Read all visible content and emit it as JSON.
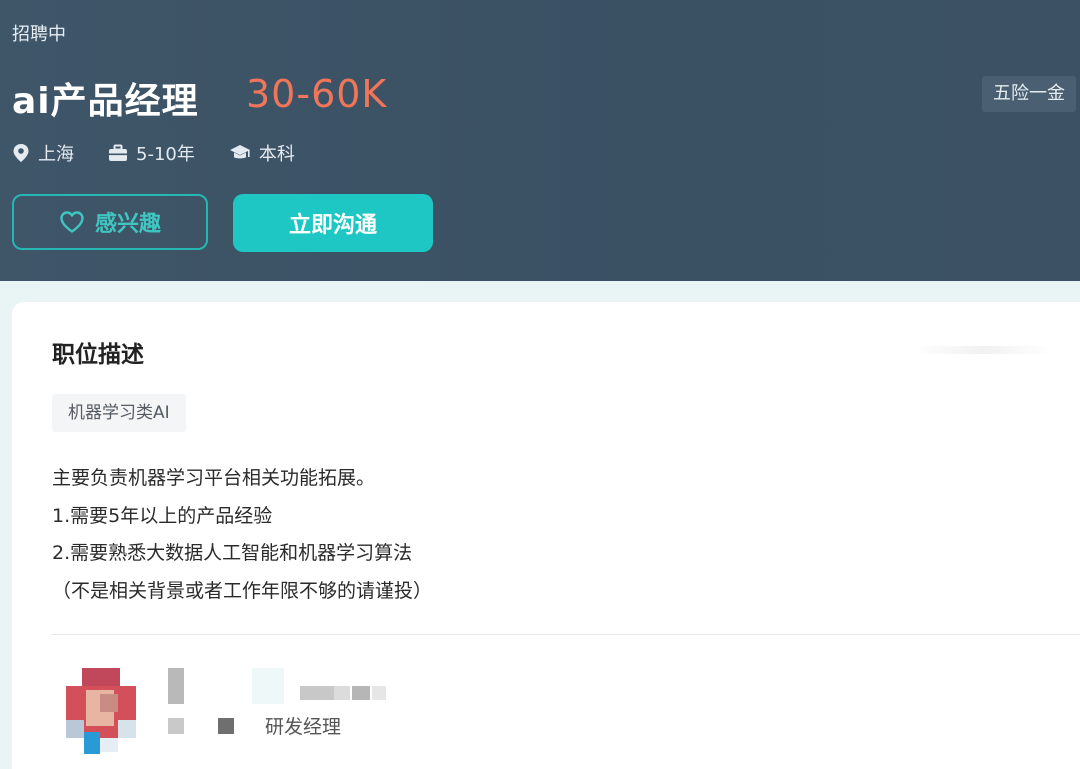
{
  "header": {
    "status": "招聘中",
    "job_title": "ai产品经理",
    "salary": "30-60K",
    "benefit": "五险一金",
    "meta": {
      "location": "上海",
      "experience": "5-10年",
      "education": "本科"
    },
    "buttons": {
      "interest": "感兴趣",
      "chat": "立即沟通"
    }
  },
  "job_card": {
    "section_title": "职位描述",
    "category_tag": "机器学习类AI",
    "description_lines": [
      "主要负责机器学习平台相关功能拓展。",
      "1.需要5年以上的产品经验",
      "2.需要熟悉大数据人工智能和机器学习算法",
      "（不是相关背景或者工作年限不够的请谨投）"
    ],
    "recruiter": {
      "title": "研发经理"
    }
  },
  "colors": {
    "header_bg": "#3f5568",
    "salary": "#f07559",
    "accent": "#1ec7c3"
  },
  "icons": [
    "location-pin-icon",
    "briefcase-icon",
    "graduation-cap-icon",
    "heart-icon"
  ]
}
